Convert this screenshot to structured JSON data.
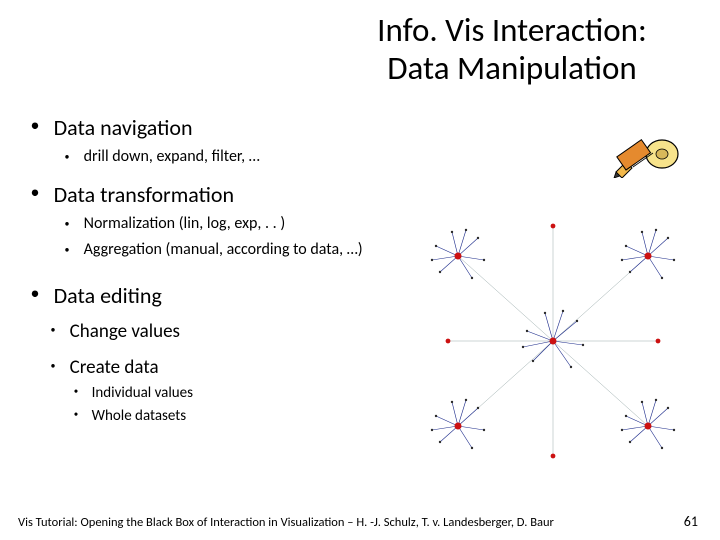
{
  "title_line1": "Info. Vis Interaction:",
  "title_line2": "Data Manipulation",
  "bullets": {
    "nav": "Data navigation",
    "nav_sub1": "drill down, expand, filter, …",
    "trans": "Data transformation",
    "trans_sub1": "Normalization (lin, log, exp, . . )",
    "trans_sub2": "Aggregation (manual, according to data, …)",
    "edit": "Data editing",
    "edit_sub1": "Change values",
    "edit_sub2": "Create data",
    "edit_sub2_a": "Individual values",
    "edit_sub2_b": "Whole datasets"
  },
  "footer": "Vis Tutorial: Opening the Black Box of Interaction in Visualization – H. -J. Schulz, T. v. Landesberger, D. Baur",
  "page": "61"
}
